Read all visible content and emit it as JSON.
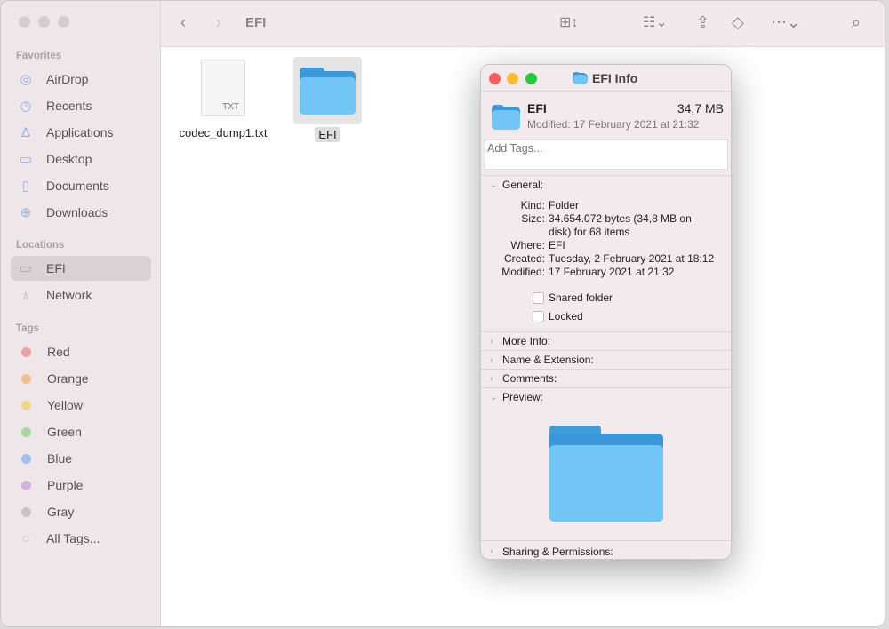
{
  "toolbar": {
    "title": "EFI",
    "icons": [
      "back-icon",
      "forward-icon",
      "icon-view-icon",
      "group-icon",
      "share-icon",
      "tag-icon",
      "more-icon",
      "search-icon"
    ]
  },
  "sidebar": {
    "favorites_label": "Favorites",
    "favorites": [
      {
        "label": "AirDrop",
        "icon": "airdrop-icon"
      },
      {
        "label": "Recents",
        "icon": "clock-icon"
      },
      {
        "label": "Applications",
        "icon": "applications-icon"
      },
      {
        "label": "Desktop",
        "icon": "desktop-icon"
      },
      {
        "label": "Documents",
        "icon": "document-icon"
      },
      {
        "label": "Downloads",
        "icon": "download-icon"
      }
    ],
    "locations_label": "Locations",
    "locations": [
      {
        "label": "EFI",
        "icon": "drive-icon",
        "selected": true
      },
      {
        "label": "Network",
        "icon": "globe-icon"
      }
    ],
    "tags_label": "Tags",
    "tags": [
      {
        "label": "Red",
        "color": "#f0a0a0"
      },
      {
        "label": "Orange",
        "color": "#f2c08f"
      },
      {
        "label": "Yellow",
        "color": "#f2d78a"
      },
      {
        "label": "Green",
        "color": "#a5d9a0"
      },
      {
        "label": "Blue",
        "color": "#9fc0f0"
      },
      {
        "label": "Purple",
        "color": "#d7b0e0"
      },
      {
        "label": "Gray",
        "color": "#c8c4c6"
      }
    ],
    "all_tags": "All Tags..."
  },
  "files": [
    {
      "name": "codec_dump1.txt",
      "type": "TXT"
    },
    {
      "name": "EFI",
      "type": "folder",
      "selected": true
    }
  ],
  "info": {
    "title": "EFI Info",
    "name": "EFI",
    "size": "34,7 MB",
    "modified": "Modified: 17 February 2021 at 21:32",
    "tags_placeholder": "Add Tags...",
    "general": "General:",
    "fields": [
      {
        "k": "Kind:",
        "v": "Folder"
      },
      {
        "k": "Size:",
        "v": "34.654.072 bytes (34,8 MB on"
      },
      {
        "k": "",
        "v": "disk) for 68 items"
      },
      {
        "k": "Where:",
        "v": "EFI"
      },
      {
        "k": "Created:",
        "v": "Tuesday, 2 February 2021 at 18:12"
      },
      {
        "k": "Modified:",
        "v": "17 February 2021 at 21:32"
      }
    ],
    "shared": "Shared folder",
    "locked": "Locked",
    "more_info": "More Info:",
    "name_ext": "Name & Extension:",
    "comments": "Comments:",
    "preview": "Preview:",
    "sharing": "Sharing & Permissions:",
    "colors": {
      "close": "#ff5f57",
      "minimize": "#febc2e",
      "zoom": "#28c840"
    }
  }
}
